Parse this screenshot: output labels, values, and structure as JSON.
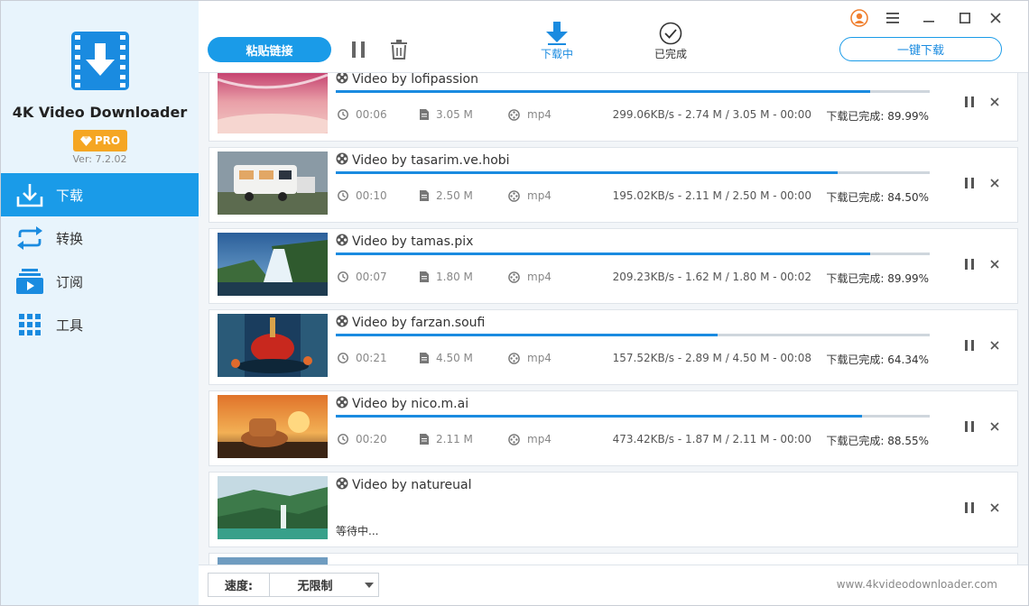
{
  "sidebar": {
    "app_name": "4K Video Downloader",
    "pro_label": "PRO",
    "version": "Ver: 7.2.02",
    "items": [
      {
        "label": "下载",
        "icon": "download-icon",
        "active": true
      },
      {
        "label": "转换",
        "icon": "convert-icon",
        "active": false
      },
      {
        "label": "订阅",
        "icon": "subscribe-icon",
        "active": false
      },
      {
        "label": "工具",
        "icon": "tools-grid-icon",
        "active": false
      }
    ]
  },
  "toolbar": {
    "paste_label": "粘贴链接",
    "tab_downloading": "下载中",
    "tab_completed": "已完成",
    "one_click_label": "一键下载"
  },
  "downloads": [
    {
      "title": "Video by lofipassion",
      "progress": 89.99,
      "duration": "00:06",
      "size": "3.05 M",
      "format": "mp4",
      "speed": "299.06KB/s - 2.74 M / 3.05 M - 00:00",
      "done": "下载已完成:  89.99%",
      "thumb": "pink"
    },
    {
      "title": "Video by tasarim.ve.hobi",
      "progress": 84.5,
      "duration": "00:10",
      "size": "2.50 M",
      "format": "mp4",
      "speed": "195.02KB/s - 2.11 M / 2.50 M - 00:00",
      "done": "下载已完成:  84.50%",
      "thumb": "house"
    },
    {
      "title": "Video by tamas.pix",
      "progress": 89.99,
      "duration": "00:07",
      "size": "1.80 M",
      "format": "mp4",
      "speed": "209.23KB/s - 1.62 M / 1.80 M - 00:02",
      "done": "下载已完成:  89.99%",
      "thumb": "waterfall"
    },
    {
      "title": "Video by farzan.soufi",
      "progress": 64.34,
      "duration": "00:21",
      "size": "4.50 M",
      "format": "mp4",
      "speed": "157.52KB/s - 2.89 M / 4.50 M - 00:08",
      "done": "下载已完成:  64.34%",
      "thumb": "fantasy"
    },
    {
      "title": "Video by nico.m.ai",
      "progress": 88.55,
      "duration": "00:20",
      "size": "2.11 M",
      "format": "mp4",
      "speed": "473.42KB/s - 1.87 M / 2.11 M - 00:00",
      "done": "下载已完成:  88.55%",
      "thumb": "sunset"
    },
    {
      "title": "Video by natureual",
      "waiting": "等待中...",
      "thumb": "forest"
    }
  ],
  "bottom": {
    "speed_label": "速度:",
    "speed_value": "无限制",
    "website": "www.4kvideodownloader.com"
  },
  "colors": {
    "accent": "#1a9be8",
    "pro": "#f5a623",
    "sidebar_bg": "#e8f4fc"
  }
}
